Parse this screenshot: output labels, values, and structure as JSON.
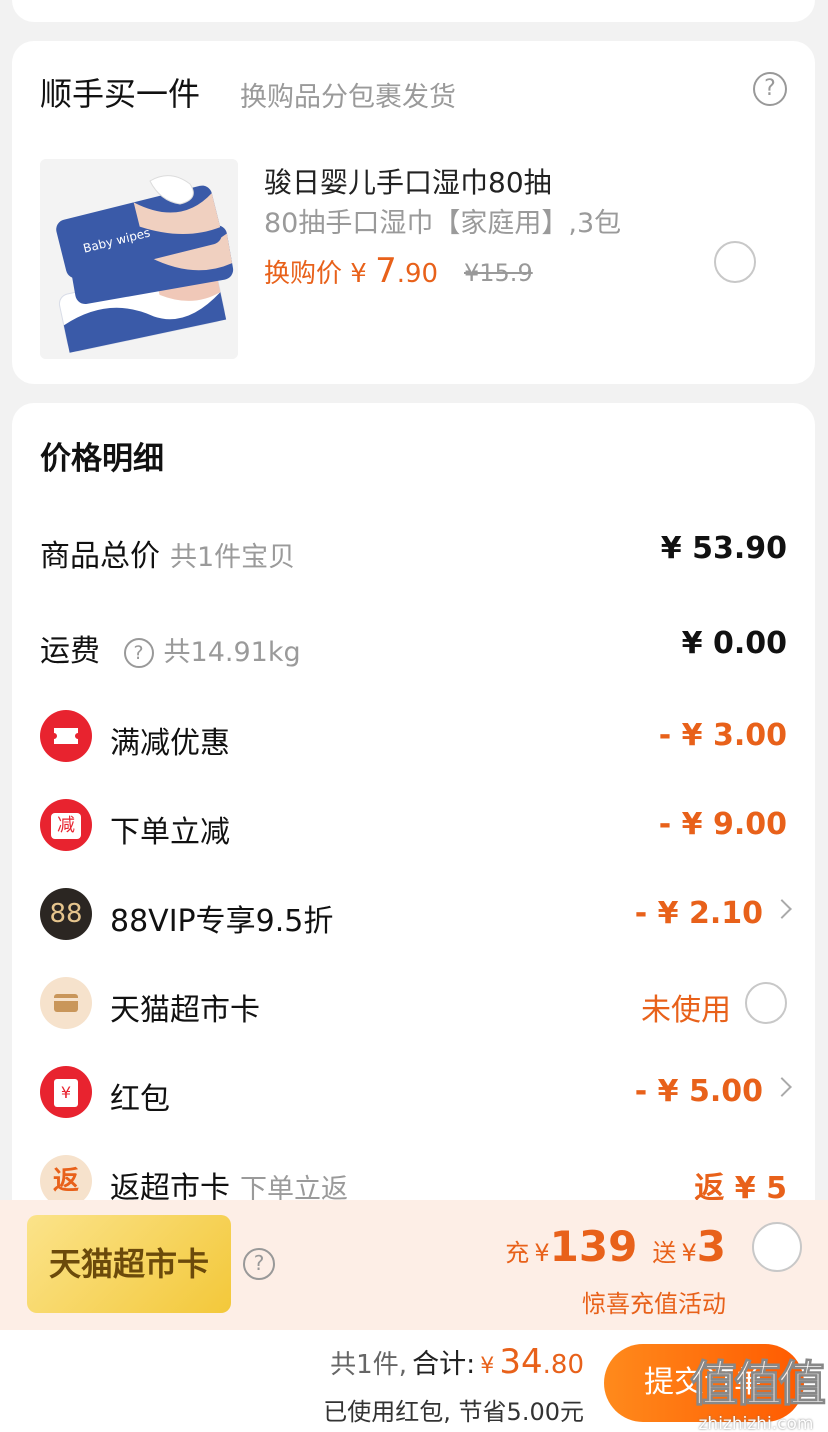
{
  "addon": {
    "title": "顺手买一件",
    "subtitle": "换购品分包裹发货",
    "help": "?",
    "product": {
      "name": "骏日婴儿手口湿巾80抽",
      "spec": "80抽手口湿巾【家庭用】,3包",
      "price_label": "换购价",
      "currency": "¥",
      "price_int": "7",
      "price_dec": ".90",
      "original_price": "¥15.9",
      "pack_text": "Baby wipes"
    }
  },
  "price_detail": {
    "title": "价格明细",
    "goods_total": {
      "label": "商品总价",
      "sub": "共1件宝贝",
      "value": "¥ 53.90"
    },
    "shipping": {
      "label": "运费",
      "help": "?",
      "sub": "共14.91kg",
      "value": "¥ 0.00"
    },
    "full_reduction": {
      "label": "满减优惠",
      "value": "- ¥ 3.00"
    },
    "order_discount": {
      "label": "下单立减",
      "icon_text": "减",
      "value": "- ¥ 9.00"
    },
    "vip": {
      "label": "88VIP专享9.5折",
      "icon_text": "88",
      "value": "- ¥ 2.10"
    },
    "market_card": {
      "label": "天猫超市卡",
      "value": "未使用"
    },
    "red_packet": {
      "label": "红包",
      "icon_text": "¥",
      "value": "- ¥ 5.00"
    },
    "cashback": {
      "label": "返超市卡",
      "sub": "下单立返",
      "icon_text": "返",
      "value": "返 ¥ 5"
    }
  },
  "recharge": {
    "badge": "天猫超市卡",
    "help": "?",
    "charge_label": "充",
    "charge_currency": "¥",
    "charge_amount": "139",
    "gift_label": "送",
    "gift_currency": "¥",
    "gift_amount": "3",
    "activity": "惊喜充值活动"
  },
  "footer": {
    "count": "共1件,",
    "total_label": "合计:",
    "currency": "¥",
    "total_int": "34",
    "total_dec": ".80",
    "saved": "已使用红包, 节省5.00元",
    "submit": "提交订单"
  },
  "watermark": {
    "big": "值值值",
    "small": "zhizhizhi.com"
  },
  "colors": {
    "accent": "#e8611a",
    "red_icon": "#e8232f",
    "gold": "#f3c83a"
  }
}
